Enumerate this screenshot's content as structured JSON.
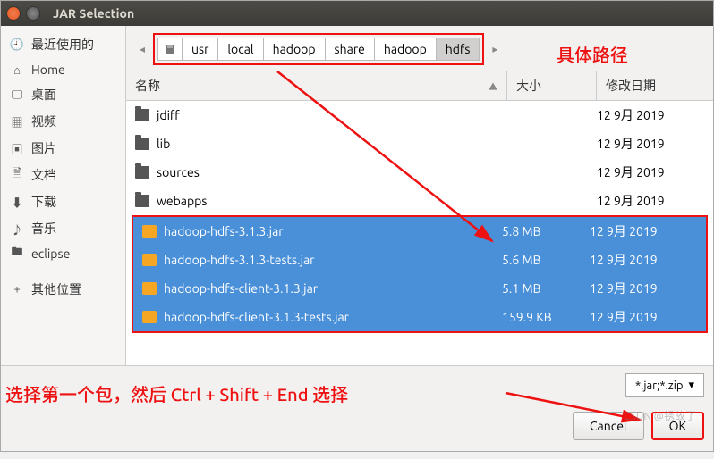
{
  "window": {
    "title": "JAR Selection"
  },
  "sidebar": {
    "items": [
      {
        "icon": "🕘",
        "label": "最近使用的"
      },
      {
        "icon": "⌂",
        "label": "Home"
      },
      {
        "icon": "🖵",
        "label": "桌面"
      },
      {
        "icon": "▦",
        "label": "视频"
      },
      {
        "icon": "▣",
        "label": "图片"
      },
      {
        "icon": "🗎",
        "label": "文档"
      },
      {
        "icon": "⬇",
        "label": "下载"
      },
      {
        "icon": "♪",
        "label": "音乐"
      },
      {
        "icon": "🖿",
        "label": "eclipse"
      },
      {
        "icon": "+",
        "label": "其他位置"
      }
    ]
  },
  "breadcrumb": {
    "segments": [
      "usr",
      "local",
      "hadoop",
      "share",
      "hadoop",
      "hdfs"
    ]
  },
  "columns": {
    "name": "名称",
    "size": "大小",
    "date": "修改日期",
    "sort": "▲"
  },
  "files": {
    "plain": [
      {
        "name": "jdiff",
        "type": "folder",
        "size": "",
        "date": "12 9月 2019"
      },
      {
        "name": "lib",
        "type": "folder",
        "size": "",
        "date": "12 9月 2019"
      },
      {
        "name": "sources",
        "type": "folder",
        "size": "",
        "date": "12 9月 2019"
      },
      {
        "name": "webapps",
        "type": "folder",
        "size": "",
        "date": "12 9月 2019"
      }
    ],
    "selected": [
      {
        "name": "hadoop-hdfs-3.1.3.jar",
        "type": "jar",
        "size": "5.8 MB",
        "date": "12 9月 2019"
      },
      {
        "name": "hadoop-hdfs-3.1.3-tests.jar",
        "type": "jar",
        "size": "5.6 MB",
        "date": "12 9月 2019"
      },
      {
        "name": "hadoop-hdfs-client-3.1.3.jar",
        "type": "jar",
        "size": "5.1 MB",
        "date": "12 9月 2019"
      },
      {
        "name": "hadoop-hdfs-client-3.1.3-tests.jar",
        "type": "jar",
        "size": "159.9 KB",
        "date": "12 9月 2019"
      }
    ]
  },
  "footer": {
    "filter": "*.jar;*.zip",
    "chevron": "▾",
    "cancel": "Cancel",
    "ok": "OK"
  },
  "annotations": {
    "path": "具体路径",
    "hint": "选择第一个包，然后 Ctrl + Shift + End 选择"
  },
  "watermark": "CSDN @锈故了"
}
